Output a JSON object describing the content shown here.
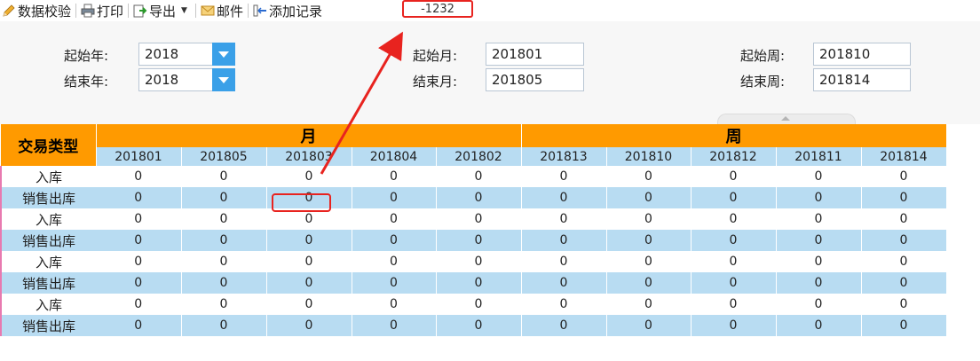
{
  "toolbar": {
    "validate_label": "数据校验",
    "print_label": "打印",
    "export_label": "导出",
    "email_label": "邮件",
    "add_record_label": "添加记录"
  },
  "annotation": {
    "value": "-1232",
    "color": "#e8231f"
  },
  "params": {
    "start_year_label": "起始年:",
    "start_year_value": "2018",
    "end_year_label": "结束年:",
    "end_year_value": "2018",
    "start_month_label": "起始月:",
    "start_month_value": "201801",
    "end_month_label": "结束月:",
    "end_month_value": "201805",
    "start_week_label": "起始周:",
    "start_week_value": "201810",
    "end_week_label": "结束周:",
    "end_week_value": "201814"
  },
  "table": {
    "corner": "交易类型",
    "group_month": "月",
    "group_week": "周",
    "month_cols": [
      "201801",
      "201805",
      "201803",
      "201804",
      "201802"
    ],
    "week_cols": [
      "201813",
      "201810",
      "201812",
      "201811",
      "201814"
    ],
    "rows": [
      {
        "label": "入库",
        "values": [
          "0",
          "0",
          "0",
          "0",
          "0",
          "0",
          "0",
          "0",
          "0",
          "0"
        ]
      },
      {
        "label": "销售出库",
        "values": [
          "0",
          "0",
          "0",
          "0",
          "0",
          "0",
          "0",
          "0",
          "0",
          "0"
        ]
      },
      {
        "label": "入库",
        "values": [
          "0",
          "0",
          "0",
          "0",
          "0",
          "0",
          "0",
          "0",
          "0",
          "0"
        ]
      },
      {
        "label": "销售出库",
        "values": [
          "0",
          "0",
          "0",
          "0",
          "0",
          "0",
          "0",
          "0",
          "0",
          "0"
        ]
      },
      {
        "label": "入库",
        "values": [
          "0",
          "0",
          "0",
          "0",
          "0",
          "0",
          "0",
          "0",
          "0",
          "0"
        ]
      },
      {
        "label": "销售出库",
        "values": [
          "0",
          "0",
          "0",
          "0",
          "0",
          "0",
          "0",
          "0",
          "0",
          "0"
        ]
      },
      {
        "label": "入库",
        "values": [
          "0",
          "0",
          "0",
          "0",
          "0",
          "0",
          "0",
          "0",
          "0",
          "0"
        ]
      },
      {
        "label": "销售出库",
        "values": [
          "0",
          "0",
          "0",
          "0",
          "0",
          "0",
          "0",
          "0",
          "0",
          "0"
        ]
      }
    ]
  },
  "colors": {
    "header_orange": "#ff9a00",
    "row_blue": "#b8dcf2",
    "select_blue": "#3aa0e8"
  }
}
